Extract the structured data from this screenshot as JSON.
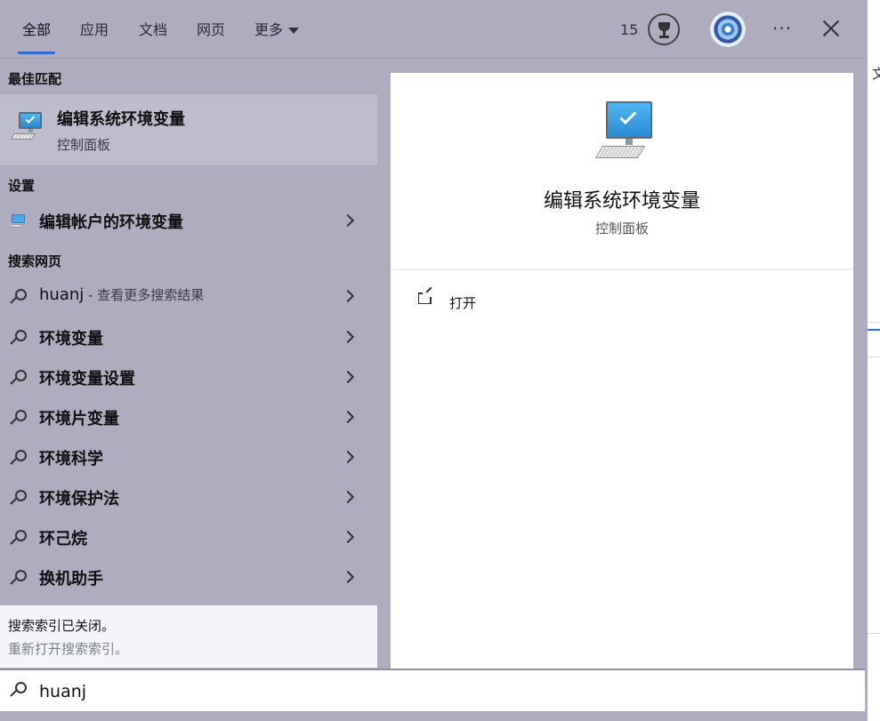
{
  "background": {
    "partial_char": "文"
  },
  "tabs": [
    {
      "label": "全部",
      "active": true
    },
    {
      "label": "应用"
    },
    {
      "label": "文档"
    },
    {
      "label": "网页"
    },
    {
      "label": "更多"
    }
  ],
  "header": {
    "points": "15"
  },
  "sections": {
    "best": "最佳匹配",
    "settings": "设置",
    "web": "搜索网页"
  },
  "best_match": {
    "title": "编辑系统环境变量",
    "subtitle": "控制面板"
  },
  "settings_items": [
    {
      "label": "编辑帐户的环境变量"
    }
  ],
  "web_items": [
    {
      "label": "huanj",
      "hint": " - 查看更多搜索结果"
    },
    {
      "label": "环境变量"
    },
    {
      "label": "环境变量设置"
    },
    {
      "label": "环境片变量"
    },
    {
      "label": "环境科学"
    },
    {
      "label": "环境保护法"
    },
    {
      "label": "环己烷"
    },
    {
      "label": "换机助手"
    }
  ],
  "notice": {
    "line1": "搜索索引已关闭。",
    "line2": "重新打开搜索索引。"
  },
  "preview": {
    "title": "编辑系统环境变量",
    "subtitle": "控制面板",
    "action_open": "打开"
  },
  "search": {
    "value": "huanj"
  },
  "colors": {
    "panel": "#aeadc0",
    "accent": "#2f6bd6",
    "highlight": "#bebdce"
  }
}
